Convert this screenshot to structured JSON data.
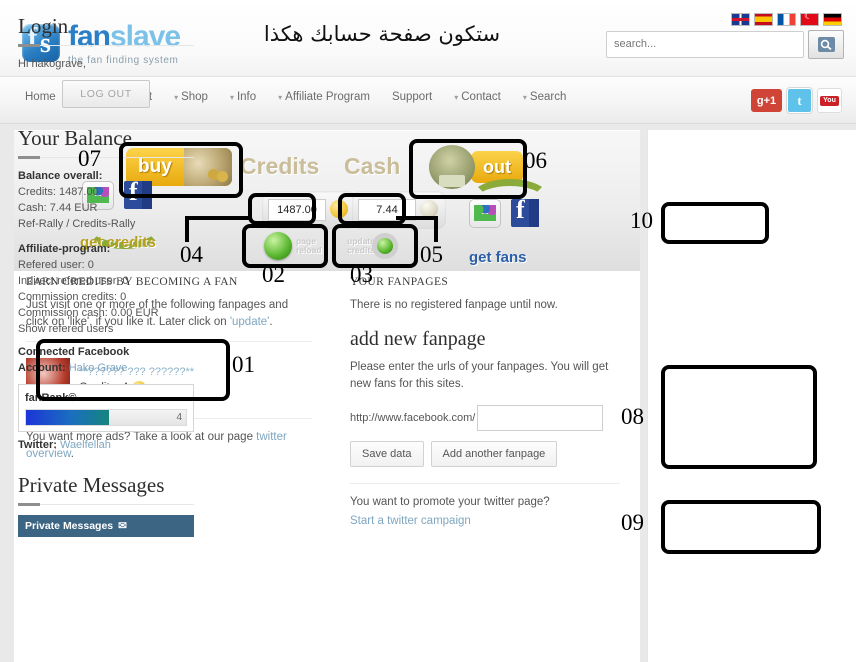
{
  "site": {
    "logo_main": "fan",
    "logo_sub": "slave",
    "tagline": "the fan finding system",
    "arabic_title": "ستكون صفحة حسابك هكذا"
  },
  "header": {
    "search_placeholder": "search...",
    "search_value": "",
    "search_button_icon": "magnifier-icon",
    "flags": [
      {
        "name": "flag-uk",
        "label": "English"
      },
      {
        "name": "flag-es",
        "label": "Espanol"
      },
      {
        "name": "flag-fr",
        "label": "Francais"
      },
      {
        "name": "flag-tr",
        "label": "Turkce"
      },
      {
        "name": "flag-de",
        "label": "Deutsch"
      }
    ]
  },
  "nav": {
    "items": [
      {
        "label": "Home",
        "caret": false
      },
      {
        "label": "Your Account",
        "caret": true
      },
      {
        "label": "Shop",
        "caret": true
      },
      {
        "label": "Info",
        "caret": true
      },
      {
        "label": "Affiliate Program",
        "caret": true
      },
      {
        "label": "Support",
        "caret": false
      },
      {
        "label": "Contact",
        "caret": true
      },
      {
        "label": "Search",
        "caret": true
      }
    ],
    "social": [
      {
        "name": "google-plus-one-icon",
        "label": "+1"
      },
      {
        "name": "twitter-icon",
        "label": "t"
      },
      {
        "name": "youtube-icon",
        "label": "You",
        "sub": "Tube"
      }
    ]
  },
  "banner": {
    "buy_label": "buy",
    "credits_label": "Credits",
    "cash_label": "Cash",
    "out_label": "out",
    "credits_value": "1487.00",
    "cash_value": "7.44",
    "page_reload_line1": "page",
    "page_reload_line2": "reload",
    "update_credits_line1": "update",
    "update_credits_line2": "credits",
    "get_credits_label": "get credits",
    "get_fans_label": "get fans"
  },
  "left_column": {
    "heading": "EARN CREDITS BY BECOMING A FAN",
    "intro_part1": "Just visit one or more of the following fanpages and click on 'like', if you like it. Later click on ",
    "intro_link": "'update'",
    "intro_part2": ".",
    "fanpage": {
      "name": "**?????? ??? ??????**",
      "credits_label": "Credits: 4"
    },
    "more_ads_text": "You want more ads? Take a look at our page ",
    "more_ads_link": "twitter overview",
    "more_ads_tail": "."
  },
  "middle_column": {
    "heading": "YOUR FANPAGES",
    "no_fanpage_text": "There is no registered fanpage until now.",
    "add_heading": "add new fanpage",
    "add_desc": "Please enter the urls of your fanpages. You will get new fans for this sites.",
    "url_prefix": "http://www.facebook.com/",
    "url_value": "",
    "save_button": "Save data",
    "add_another_button": "Add another fanpage",
    "promote_text": "You want to promote your twitter page?",
    "promote_link": "Start a twitter campaign"
  },
  "rail": {
    "login_heading": "Login",
    "greeting": "Hi hakograve,",
    "logout_button": "LOG OUT",
    "balance_heading": "Your Balance",
    "balance_overall_label": "Balance overall:",
    "credits_line": "Credits: 1487.00",
    "cash_line": "Cash: 7.44 EUR",
    "rally_link": "Ref-Rally / Credits-Rally",
    "affiliate_label": "Affiliate-program:",
    "refered_user": "Refered user: 0",
    "indirect_refered_user": "Indirect refered user: 0",
    "commission_credits": "Commission credits: 0",
    "commission_cash": "Commission cash: 0.00 EUR",
    "show_refered_link": "Show refered users",
    "connected_fb_label": "Connected Facebook",
    "account_label": "Account:",
    "account_value": "Hako Grave",
    "fanrank_label": "fanRank©",
    "fanrank_value": "4",
    "fanrank_percent": 52,
    "twitter_label": "Twitter:",
    "twitter_value": "Waelfellah",
    "pm_heading": "Private Messages",
    "pm_bar_label": "Private Messages",
    "pm_bar_icon": "envelope-icon"
  },
  "annotations": {
    "n01": "01",
    "n02": "02",
    "n03": "03",
    "n04": "04",
    "n05": "05",
    "n06": "06",
    "n07": "07",
    "n08": "08",
    "n09": "09",
    "n10": "10"
  },
  "colors": {
    "accent_blue": "#2a7fc9",
    "gold": "#e8a90d",
    "link": "#7fa6c0",
    "pm_bar": "#3c6584",
    "annotation": "#000000"
  }
}
